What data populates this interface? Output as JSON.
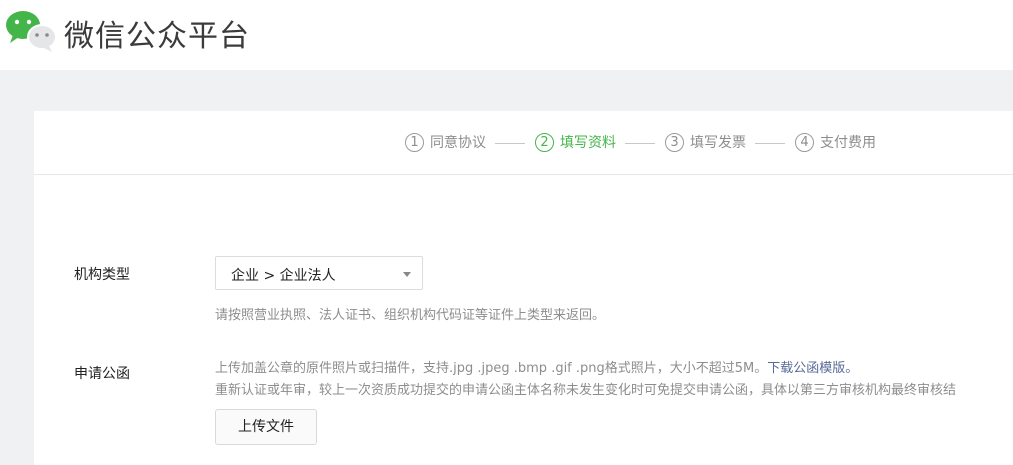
{
  "brand": {
    "title": "微信公众平台",
    "logo_icon": "wechat-logo-icon"
  },
  "steps": [
    {
      "num": "1",
      "label": "同意协议",
      "active": false
    },
    {
      "num": "2",
      "label": "填写资料",
      "active": true
    },
    {
      "num": "3",
      "label": "填写发票",
      "active": false
    },
    {
      "num": "4",
      "label": "支付费用",
      "active": false
    }
  ],
  "form": {
    "org_type": {
      "label": "机构类型",
      "value": "企业 > 企业法人",
      "hint": "请按照营业执照、法人证书、组织机构代码证等证件上类型来返回。"
    },
    "application_letter": {
      "label": "申请公函",
      "hint_line1": "上传加盖公章的原件照片或扫描件，支持.jpg .jpeg .bmp .gif .png格式照片，大小不超过5M。",
      "download_link": "下载公函模版",
      "hint_line1_end": "。",
      "hint_line2": "重新认证或年审，较上一次资质成功提交的申请公函主体名称未发生变化时可免提交申请公函，具体以第三方审核机构最终审核结",
      "upload_button": "上传文件"
    }
  },
  "colors": {
    "accent": "#44b549",
    "link": "#576b95",
    "hint": "#8d8d8d"
  }
}
